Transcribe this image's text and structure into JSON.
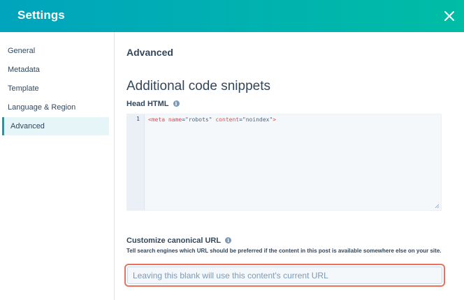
{
  "header": {
    "title": "Settings",
    "close_icon": "close-icon"
  },
  "sidebar": {
    "items": [
      {
        "label": "General",
        "active": false
      },
      {
        "label": "Metadata",
        "active": false
      },
      {
        "label": "Template",
        "active": false
      },
      {
        "label": "Language & Region",
        "active": false
      },
      {
        "label": "Advanced",
        "active": true
      }
    ]
  },
  "main": {
    "section_title": "Advanced",
    "heading": "Additional code snippets",
    "head_html": {
      "label": "Head HTML",
      "info_icon": "info-icon",
      "line_number": "1",
      "code": {
        "tag_open": "<meta",
        "attr1": "name",
        "eq1": "=",
        "val1": "\"robots\"",
        "attr2": "content",
        "eq2": "=",
        "val2": "\"noindex\"",
        "tag_close": ">"
      }
    },
    "canonical": {
      "label": "Customize canonical URL",
      "info_icon": "info-icon",
      "helper": "Tell search engines which URL should be preferred if the content in this post is available somewhere else on your site.",
      "value": "",
      "placeholder": "Leaving this blank will use this content's current URL"
    }
  },
  "colors": {
    "header_start": "#00a4bd",
    "header_end": "#00bda5",
    "active_nav_bg": "#e5f5f8",
    "active_nav_border": "#00a4bd",
    "highlight_border": "#e8735d"
  }
}
